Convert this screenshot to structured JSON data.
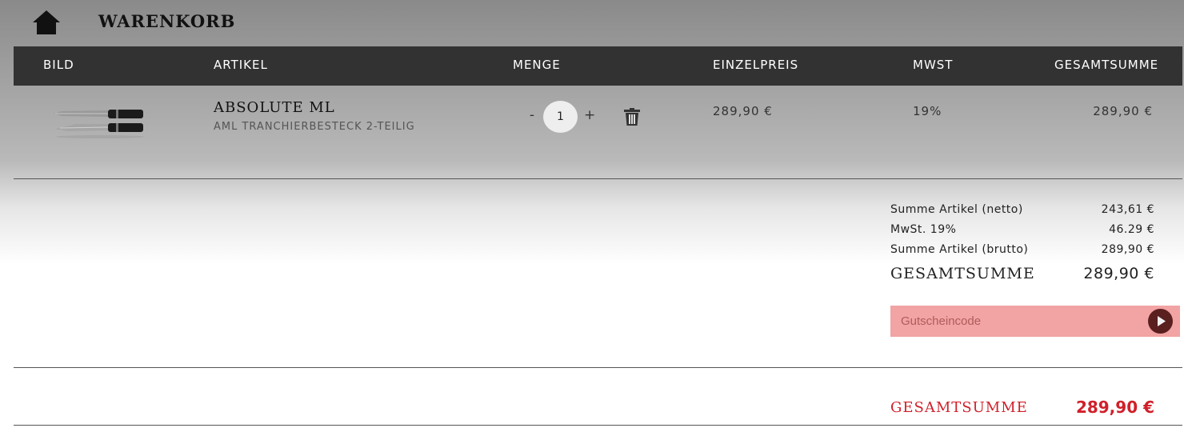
{
  "header": {
    "title": "WARENKORB",
    "home_icon": "home-icon"
  },
  "table": {
    "columns": [
      "BILD",
      "ARTIKEL",
      "MENGE",
      "EINZELPREIS",
      "MWST",
      "GESAMTSUMME"
    ],
    "rows": [
      {
        "image": "knife-set-image",
        "name": "ABSOLUTE ML",
        "subtitle": "AML TRANCHIERBESTECK 2-TEILIG",
        "qty_minus": "-",
        "qty": "1",
        "qty_plus": "+",
        "delete_icon": "trash-icon",
        "unit_price": "289,90 €",
        "vat": "19%",
        "total": "289,90 €"
      }
    ]
  },
  "summary": {
    "net_label": "Summe Artikel (netto)",
    "net_value": "243,61 €",
    "vat_label": "MwSt. 19%",
    "vat_value": "46.29 €",
    "gross_label": "Summe Artikel (brutto)",
    "gross_value": "289,90 €",
    "total_label": "GESAMTSUMME",
    "total_value": "289,90 €"
  },
  "voucher": {
    "placeholder": "Gutscheincode",
    "submit_icon": "play-arrow-icon"
  },
  "grand_total": {
    "label": "GESAMTSUMME",
    "value": "289,90 €"
  },
  "colors": {
    "header_bar": "#323232",
    "accent_red": "#d0202a",
    "voucher_bg": "#f2a3a3",
    "voucher_button": "#5a1f1f"
  }
}
